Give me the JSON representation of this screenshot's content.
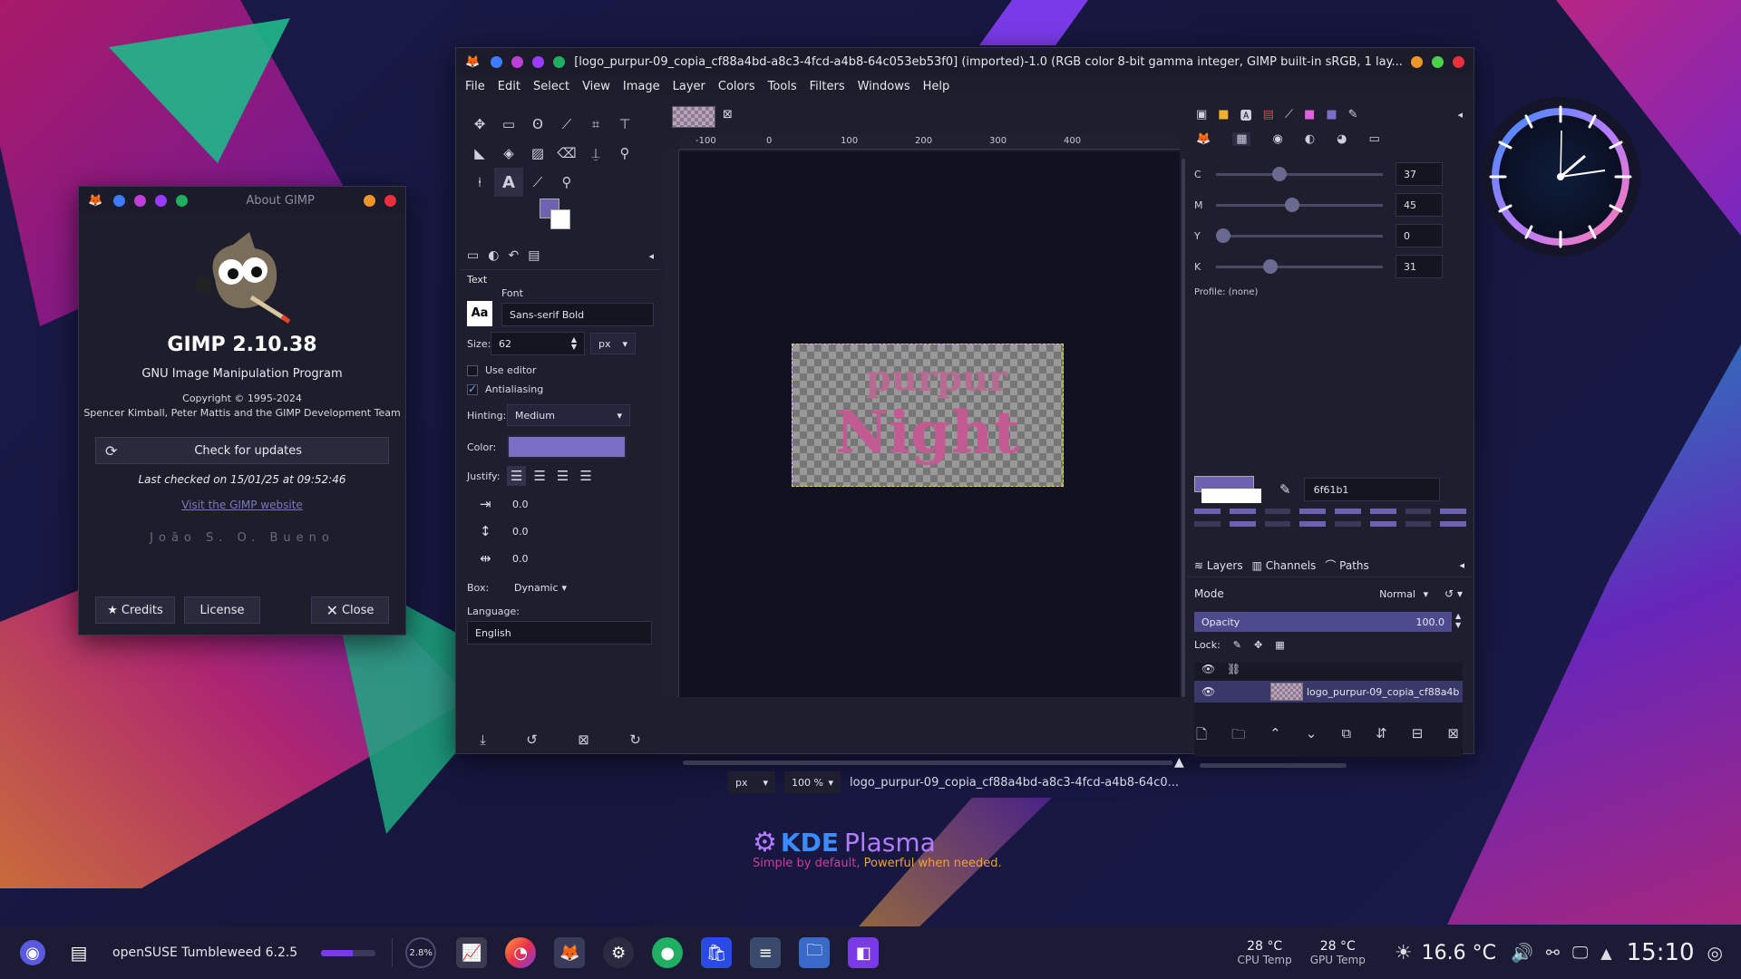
{
  "about": {
    "title": "About GIMP",
    "app_name": "GIMP 2.10.38",
    "subtitle": "GNU Image Manipulation Program",
    "copyright": "Copyright © 1995-2024",
    "authors": "Spencer Kimball, Peter Mattis and the GIMP Development Team",
    "check_updates": "Check for updates",
    "last_checked": "Last checked on 15/01/25 at 09:52:46",
    "visit": "Visit the GIMP website",
    "author_credit": "João S. O. Bueno",
    "credits": "Credits",
    "license": "License",
    "close": "Close"
  },
  "gimp": {
    "title": "[logo_purpur-09_copia_cf88a4bd-a8c3-4fcd-a4b8-64c053eb53f0] (imported)-1.0 (RGB color 8-bit gamma integer, GIMP built-in sRGB, 1 lay...",
    "menu": [
      "File",
      "Edit",
      "Select",
      "View",
      "Image",
      "Layer",
      "Colors",
      "Tools",
      "Filters",
      "Windows",
      "Help"
    ],
    "tool_options": {
      "heading": "Text",
      "font_label": "Font",
      "font_value": "Sans-serif Bold",
      "size_label": "Size:",
      "size_value": "62",
      "size_unit": "px",
      "use_editor": "Use editor",
      "antialiasing": "Antialiasing",
      "hinting_label": "Hinting:",
      "hinting_value": "Medium",
      "color_label": "Color:",
      "justify_label": "Justify:",
      "indent": "0.0",
      "line_spacing": "0.0",
      "letter_spacing": "0.0",
      "box_label": "Box:",
      "box_value": "Dynamic",
      "language_label": "Language:",
      "language_value": "English"
    },
    "ruler_ticks": [
      "-100",
      "0",
      "100",
      "200",
      "300",
      "400"
    ],
    "image_text_1": "purpur",
    "image_text_2": "Night",
    "status": {
      "unit": "px",
      "zoom": "100 %",
      "filename": "logo_purpur-09_copia_cf88a4bd-a8c3-4fcd-a4b8-64c0..."
    },
    "cmyk": [
      {
        "ch": "C",
        "value": "37",
        "fraction": 0.37
      },
      {
        "ch": "M",
        "value": "45",
        "fraction": 0.45
      },
      {
        "ch": "Y",
        "value": "0",
        "fraction": 0.0
      },
      {
        "ch": "K",
        "value": "31",
        "fraction": 0.31
      }
    ],
    "profile": "Profile: (none)",
    "hex": "6f61b1",
    "fg_color": "#6f61b1",
    "layers": {
      "tab_layers": "Layers",
      "tab_channels": "Channels",
      "tab_paths": "Paths",
      "mode_label": "Mode",
      "mode_value": "Normal",
      "opacity_label": "Opacity",
      "opacity_value": "100.0",
      "lock_label": "Lock:",
      "layer_name": "logo_purpur-09_copia_cf88a4b"
    }
  },
  "kde": {
    "brand": "KDE",
    "product": "Plasma",
    "tagline_1": "Simple by default,",
    "tagline_2": "Powerful when needed."
  },
  "taskbar": {
    "os": "openSUSE Tumbleweed 6.2.5",
    "cpu_percent": "2.8%",
    "cpu_temp": "28 °C",
    "cpu_temp_label": "CPU Temp",
    "gpu_temp": "28 °C",
    "gpu_temp_label": "GPU Temp",
    "weather": "16.6 °C",
    "time": "15:10"
  }
}
